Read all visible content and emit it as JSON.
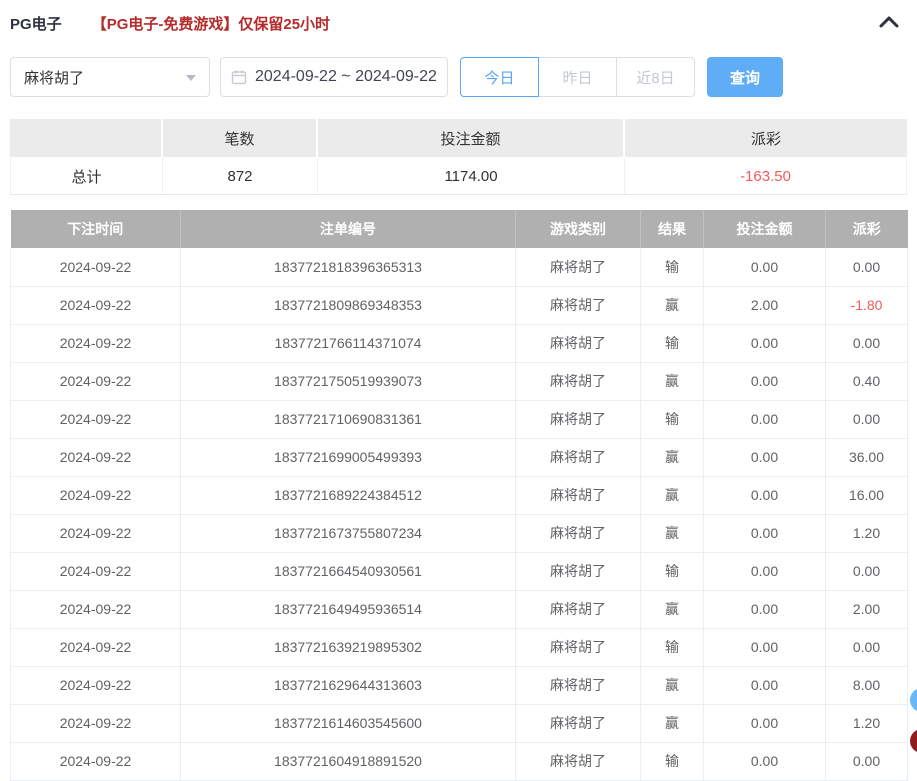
{
  "header": {
    "title": "PG电子",
    "notice": "【PG电子-免费游戏】仅保留25小时"
  },
  "filters": {
    "game_select": {
      "value": "麻将胡了"
    },
    "date_range": {
      "value": "2024-09-22 ~ 2024-09-22"
    },
    "quick_ranges": [
      {
        "label": "今日",
        "active": true
      },
      {
        "label": "昨日",
        "active": false
      },
      {
        "label": "近8日",
        "active": false
      }
    ],
    "search_button": "查询"
  },
  "summary": {
    "col_headers": [
      "笔数",
      "投注金额",
      "派彩"
    ],
    "row_label": "总计",
    "count": "872",
    "bet_amount": "1174.00",
    "payout": "-163.50"
  },
  "bets_table": {
    "headers": [
      "下注时间",
      "注单编号",
      "游戏类别",
      "结果",
      "投注金额",
      "派彩"
    ],
    "rows": [
      [
        "2024-09-22",
        "1837721818396365313",
        "麻将胡了",
        "输",
        "0.00",
        "0.00"
      ],
      [
        "2024-09-22",
        "1837721809869348353",
        "麻将胡了",
        "赢",
        "2.00",
        "-1.80"
      ],
      [
        "2024-09-22",
        "1837721766114371074",
        "麻将胡了",
        "输",
        "0.00",
        "0.00"
      ],
      [
        "2024-09-22",
        "1837721750519939073",
        "麻将胡了",
        "赢",
        "0.00",
        "0.40"
      ],
      [
        "2024-09-22",
        "1837721710690831361",
        "麻将胡了",
        "输",
        "0.00",
        "0.00"
      ],
      [
        "2024-09-22",
        "1837721699005499393",
        "麻将胡了",
        "赢",
        "0.00",
        "36.00"
      ],
      [
        "2024-09-22",
        "1837721689224384512",
        "麻将胡了",
        "赢",
        "0.00",
        "16.00"
      ],
      [
        "2024-09-22",
        "1837721673755807234",
        "麻将胡了",
        "赢",
        "0.00",
        "1.20"
      ],
      [
        "2024-09-22",
        "1837721664540930561",
        "麻将胡了",
        "输",
        "0.00",
        "0.00"
      ],
      [
        "2024-09-22",
        "1837721649495936514",
        "麻将胡了",
        "赢",
        "0.00",
        "2.00"
      ],
      [
        "2024-09-22",
        "1837721639219895302",
        "麻将胡了",
        "输",
        "0.00",
        "0.00"
      ],
      [
        "2024-09-22",
        "1837721629644313603",
        "麻将胡了",
        "赢",
        "0.00",
        "8.00"
      ],
      [
        "2024-09-22",
        "1837721614603545600",
        "麻将胡了",
        "赢",
        "0.00",
        "1.20"
      ],
      [
        "2024-09-22",
        "1837721604918891520",
        "麻将胡了",
        "输",
        "0.00",
        "0.00"
      ]
    ]
  },
  "colors": {
    "primary_blue": "#5fadf4",
    "danger_red": "#f15b5b",
    "notice_red": "#b52b2b",
    "table_header_gray": "#b0b0b0"
  }
}
